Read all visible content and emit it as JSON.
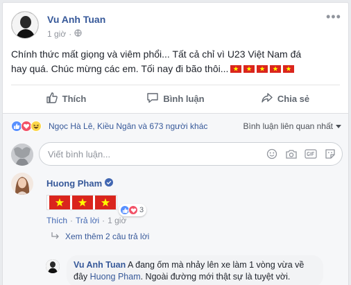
{
  "post": {
    "author": "Vu Anh Tuan",
    "time": "1 giờ",
    "privacy_icon": "globe-icon",
    "text": "Chính thức mất giọng và viêm phổi... Tất cả chỉ vì U23 Việt Nam đá hay quá. Chúc mừng các em. Tối nay đi bão thôi...",
    "flag_count": 5
  },
  "actions": {
    "like": "Thích",
    "comment": "Bình luận",
    "share": "Chia sẻ"
  },
  "reactions": {
    "icons": [
      "like-icon",
      "love-icon",
      "haha-icon"
    ],
    "names": "Ngọc Hà Lê, Kiều Ngân và 673 người khác",
    "sort": "Bình luận liên quan nhất"
  },
  "composer": {
    "placeholder": "Viết bình luận..."
  },
  "comment": {
    "author": "Huong Pham",
    "flag_count": 3,
    "reaction_count": "3",
    "like": "Thích",
    "reply": "Trả lời",
    "time": "1 giờ",
    "separator": "·"
  },
  "see_more": "Xem thêm 2 câu trả lời",
  "reply": {
    "author": "Vu Anh Tuan",
    "text_before": "A đang ốm mà nhảy lên xe làm 1 vòng vừa về đây",
    "tag": "Huong Pham",
    "text_after": ". Ngoài đường mới thật sự là tuyệt vời."
  },
  "colors": {
    "link": "#365899",
    "flag_red": "#da251d",
    "flag_star": "#ffff00",
    "like_blue": "#5890ff",
    "love_red": "#f25268",
    "haha_yellow": "#fcd74a"
  }
}
